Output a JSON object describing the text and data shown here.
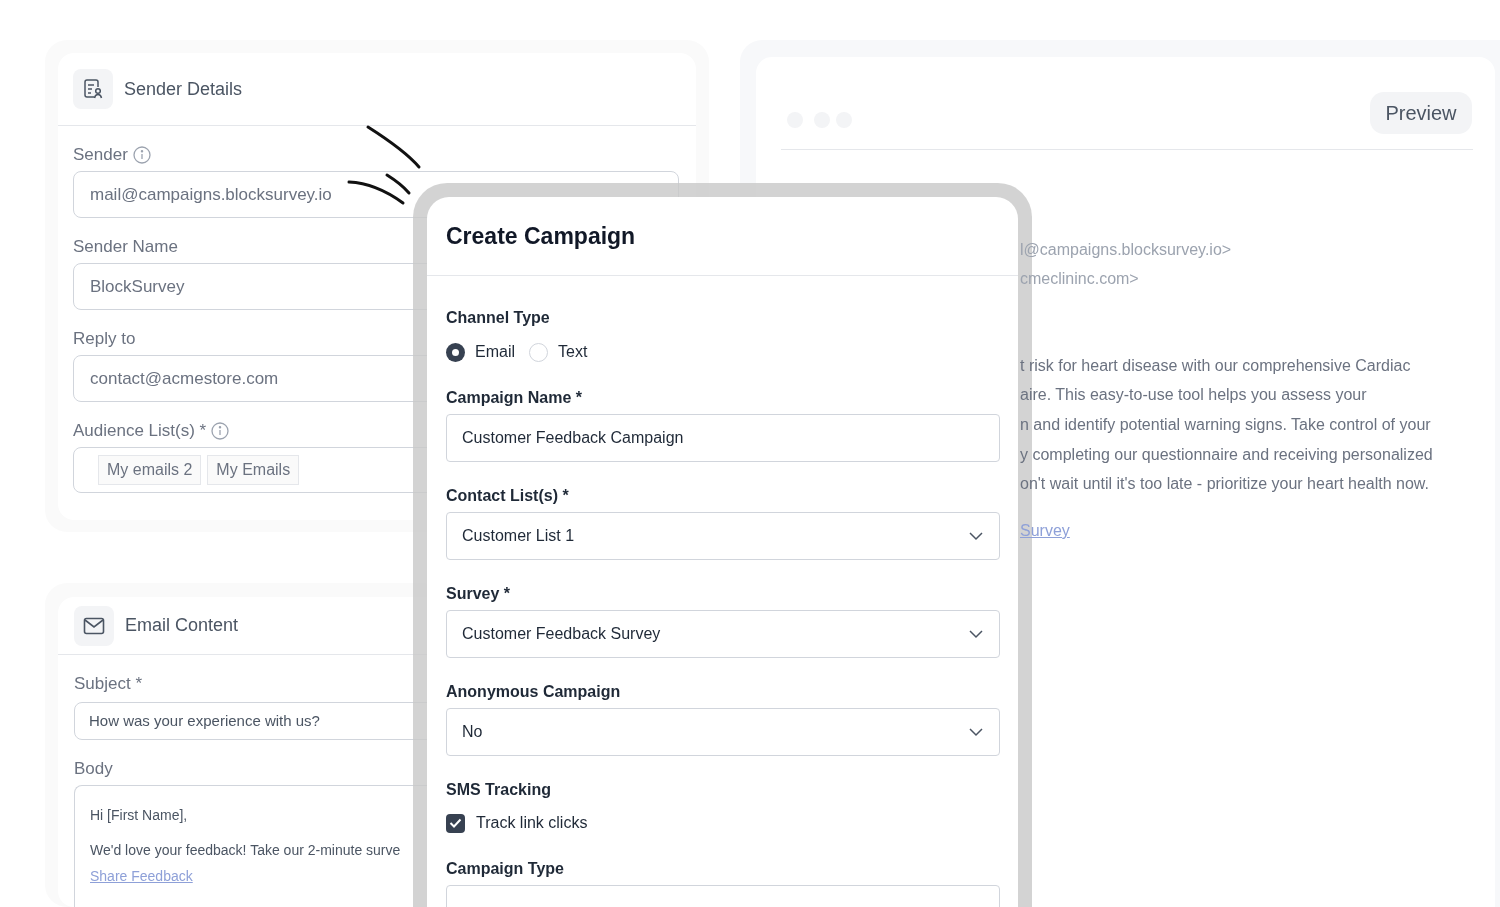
{
  "sender_details": {
    "title": "Sender Details",
    "fields": [
      {
        "kind": "text",
        "label": "Sender",
        "info": true,
        "value": "mail@campaigns.blocksurvey.io"
      },
      {
        "kind": "text",
        "label": "Sender Name",
        "info": false,
        "value": "BlockSurvey"
      },
      {
        "kind": "text",
        "label": "Reply to",
        "info": false,
        "value": "contact@acmestore.com"
      },
      {
        "kind": "tags",
        "label": "Audience List(s) *",
        "info": true,
        "tags": [
          "My emails 2",
          "My Emails"
        ]
      }
    ]
  },
  "email_content": {
    "title": "Email Content",
    "subject_label": "Subject *",
    "subject": "How was your experience with us?",
    "body_label": "Body",
    "body": [
      {
        "kind": "text",
        "text": "Hi [First Name],"
      },
      {
        "kind": "text",
        "text": "We'd love your feedback! Take our 2-minute surve"
      },
      {
        "kind": "link",
        "text": "Share Feedback"
      }
    ]
  },
  "preview": {
    "button": "Preview",
    "lines": [
      {
        "kind": "meta",
        "text": "l@campaigns.blocksurvey.io>"
      },
      {
        "kind": "meta",
        "text": "cmeclininc.com>"
      },
      {
        "kind": "paragraph",
        "text": "t risk for heart disease with our comprehensive Cardiac"
      },
      {
        "kind": "paragraph",
        "text": "aire. This easy-to-use tool helps you assess your"
      },
      {
        "kind": "paragraph",
        "text": "n and identify potential warning signs. Take control of your"
      },
      {
        "kind": "paragraph",
        "text": "y completing our questionnaire and receiving personalized"
      },
      {
        "kind": "paragraph",
        "text": "on't wait until it's too late - prioritize your heart health now."
      },
      {
        "kind": "link",
        "text": "Survey"
      }
    ]
  },
  "modal": {
    "title": "Create Campaign",
    "fields": [
      {
        "kind": "radio",
        "label": "Channel Type",
        "options": [
          {
            "label": "Email",
            "selected": true
          },
          {
            "label": "Text",
            "selected": false
          }
        ]
      },
      {
        "kind": "text",
        "label": "Campaign Name *",
        "value": "Customer Feedback Campaign"
      },
      {
        "kind": "select",
        "label": "Contact List(s) *",
        "value": "Customer List 1"
      },
      {
        "kind": "select",
        "label": "Survey *",
        "value": "Customer Feedback Survey"
      },
      {
        "kind": "select",
        "label": "Anonymous Campaign",
        "value": "No"
      },
      {
        "kind": "checkbox",
        "label": "SMS Tracking",
        "option": "Track link clicks",
        "checked": true
      },
      {
        "kind": "cut",
        "label": "Campaign Type"
      }
    ]
  }
}
